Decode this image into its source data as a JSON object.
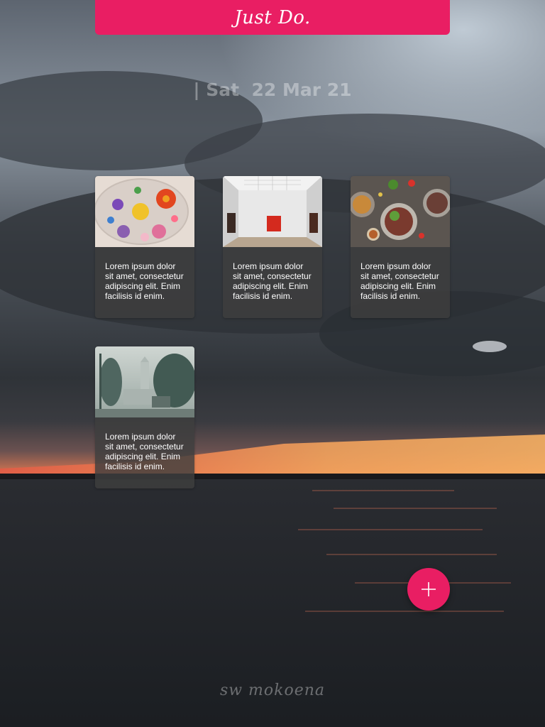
{
  "header": {
    "title": "Just Do."
  },
  "date": {
    "text": "| Sat  22 Mar 21"
  },
  "cards": [
    {
      "image_icon": "embroidered-flowers-photo",
      "text": "Lorem ipsum dolor sit amet, consectetur adipiscing elit. Enim facilisis id enim."
    },
    {
      "image_icon": "gallery-room-photo",
      "text": "Lorem ipsum dolor sit amet, consectetur adipiscing elit. Enim facilisis id enim."
    },
    {
      "image_icon": "food-plates-photo",
      "text": "Lorem ipsum dolor sit amet, consectetur adipiscing elit. Enim facilisis id enim."
    },
    {
      "image_icon": "misty-street-photo",
      "text": "Lorem ipsum dolor sit amet, consectetur adipiscing elit. Enim facilisis id enim."
    }
  ],
  "fab": {
    "icon": "plus-icon",
    "color": "#e91e63"
  },
  "footer": {
    "signature": "sw mokoena"
  },
  "colors": {
    "accent": "#e91e63"
  }
}
